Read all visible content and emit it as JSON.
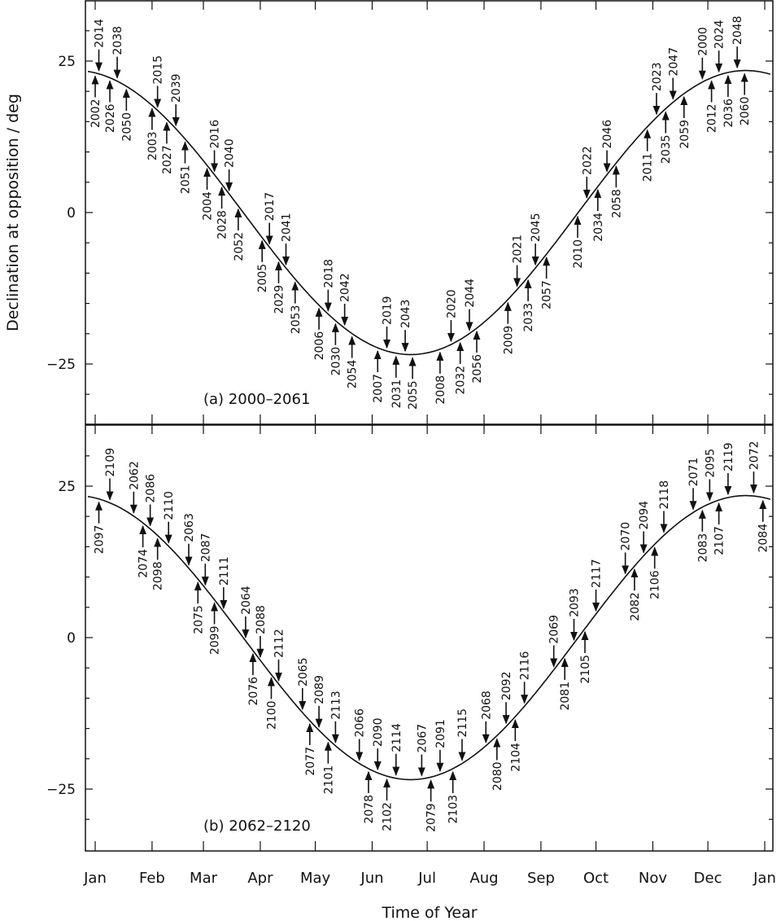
{
  "chart_data": {
    "type": "scatter",
    "xlabel": "Time of Year",
    "ylabel": "Declination at opposition / deg",
    "x_ticks": [
      "Jan",
      "Feb",
      "Mar",
      "Apr",
      "May",
      "Jun",
      "Jul",
      "Aug",
      "Sep",
      "Oct",
      "Nov",
      "Dec",
      "Jan"
    ],
    "y_ticks": [
      25,
      0,
      -25
    ],
    "y_tick_labels": [
      "25",
      "0",
      "−25"
    ],
    "ylim": [
      -35,
      35
    ],
    "grid": false,
    "curve": {
      "amplitude_deg": 23.44,
      "minimum_date": "06-22"
    },
    "panels": [
      {
        "label": "(a) 2000–2061",
        "points": [
          {
            "year": "2002",
            "date": "01-01",
            "dir": "up"
          },
          {
            "year": "2014",
            "date": "01-03",
            "dir": "down"
          },
          {
            "year": "2026",
            "date": "01-09",
            "dir": "up"
          },
          {
            "year": "2038",
            "date": "01-13",
            "dir": "down"
          },
          {
            "year": "2050",
            "date": "01-18",
            "dir": "up"
          },
          {
            "year": "2003",
            "date": "02-01",
            "dir": "up"
          },
          {
            "year": "2015",
            "date": "02-04",
            "dir": "down"
          },
          {
            "year": "2027",
            "date": "02-09",
            "dir": "up"
          },
          {
            "year": "2039",
            "date": "02-14",
            "dir": "down"
          },
          {
            "year": "2051",
            "date": "02-19",
            "dir": "up"
          },
          {
            "year": "2004",
            "date": "03-03",
            "dir": "up"
          },
          {
            "year": "2016",
            "date": "03-07",
            "dir": "down"
          },
          {
            "year": "2028",
            "date": "03-11",
            "dir": "up"
          },
          {
            "year": "2040",
            "date": "03-15",
            "dir": "down"
          },
          {
            "year": "2052",
            "date": "03-20",
            "dir": "up"
          },
          {
            "year": "2005",
            "date": "04-02",
            "dir": "up"
          },
          {
            "year": "2017",
            "date": "04-06",
            "dir": "down"
          },
          {
            "year": "2029",
            "date": "04-11",
            "dir": "up"
          },
          {
            "year": "2041",
            "date": "04-15",
            "dir": "down"
          },
          {
            "year": "2053",
            "date": "04-20",
            "dir": "up"
          },
          {
            "year": "2006",
            "date": "05-03",
            "dir": "up"
          },
          {
            "year": "2018",
            "date": "05-08",
            "dir": "down"
          },
          {
            "year": "2030",
            "date": "05-12",
            "dir": "up"
          },
          {
            "year": "2042",
            "date": "05-17",
            "dir": "down"
          },
          {
            "year": "2054",
            "date": "05-21",
            "dir": "up"
          },
          {
            "year": "2007",
            "date": "06-04",
            "dir": "up"
          },
          {
            "year": "2019",
            "date": "06-09",
            "dir": "down"
          },
          {
            "year": "2031",
            "date": "06-14",
            "dir": "up"
          },
          {
            "year": "2043",
            "date": "06-19",
            "dir": "down"
          },
          {
            "year": "2055",
            "date": "06-23",
            "dir": "up"
          },
          {
            "year": "2008",
            "date": "07-08",
            "dir": "up"
          },
          {
            "year": "2020",
            "date": "07-14",
            "dir": "down"
          },
          {
            "year": "2032",
            "date": "07-19",
            "dir": "up"
          },
          {
            "year": "2044",
            "date": "07-24",
            "dir": "down"
          },
          {
            "year": "2056",
            "date": "07-28",
            "dir": "up"
          },
          {
            "year": "2009",
            "date": "08-14",
            "dir": "up"
          },
          {
            "year": "2021",
            "date": "08-19",
            "dir": "down"
          },
          {
            "year": "2033",
            "date": "08-25",
            "dir": "up"
          },
          {
            "year": "2045",
            "date": "08-29",
            "dir": "down"
          },
          {
            "year": "2057",
            "date": "09-04",
            "dir": "up"
          },
          {
            "year": "2010",
            "date": "09-21",
            "dir": "up"
          },
          {
            "year": "2022",
            "date": "09-26",
            "dir": "down"
          },
          {
            "year": "2034",
            "date": "10-02",
            "dir": "up"
          },
          {
            "year": "2046",
            "date": "10-07",
            "dir": "down"
          },
          {
            "year": "2058",
            "date": "10-12",
            "dir": "up"
          },
          {
            "year": "2011",
            "date": "10-29",
            "dir": "up"
          },
          {
            "year": "2023",
            "date": "11-03",
            "dir": "down"
          },
          {
            "year": "2035",
            "date": "11-08",
            "dir": "up"
          },
          {
            "year": "2047",
            "date": "11-12",
            "dir": "down"
          },
          {
            "year": "2059",
            "date": "11-18",
            "dir": "up"
          },
          {
            "year": "2000",
            "date": "11-28",
            "dir": "down"
          },
          {
            "year": "2012",
            "date": "12-03",
            "dir": "up"
          },
          {
            "year": "2024",
            "date": "12-07",
            "dir": "down"
          },
          {
            "year": "2036",
            "date": "12-12",
            "dir": "up"
          },
          {
            "year": "2048",
            "date": "12-17",
            "dir": "down"
          },
          {
            "year": "2060",
            "date": "12-21",
            "dir": "up"
          }
        ]
      },
      {
        "label": "(b) 2062–2120",
        "points": [
          {
            "year": "2097",
            "date": "01-03",
            "dir": "up"
          },
          {
            "year": "2109",
            "date": "01-09",
            "dir": "down"
          },
          {
            "year": "2062",
            "date": "01-22",
            "dir": "down"
          },
          {
            "year": "2074",
            "date": "01-27",
            "dir": "up"
          },
          {
            "year": "2086",
            "date": "01-31",
            "dir": "down"
          },
          {
            "year": "2098",
            "date": "02-04",
            "dir": "up"
          },
          {
            "year": "2110",
            "date": "02-10",
            "dir": "down"
          },
          {
            "year": "2063",
            "date": "02-21",
            "dir": "down"
          },
          {
            "year": "2075",
            "date": "02-26",
            "dir": "up"
          },
          {
            "year": "2087",
            "date": "03-02",
            "dir": "down"
          },
          {
            "year": "2099",
            "date": "03-07",
            "dir": "up"
          },
          {
            "year": "2111",
            "date": "03-12",
            "dir": "down"
          },
          {
            "year": "2064",
            "date": "03-24",
            "dir": "down"
          },
          {
            "year": "2076",
            "date": "03-28",
            "dir": "up"
          },
          {
            "year": "2088",
            "date": "04-01",
            "dir": "down"
          },
          {
            "year": "2100",
            "date": "04-07",
            "dir": "up"
          },
          {
            "year": "2112",
            "date": "04-11",
            "dir": "down"
          },
          {
            "year": "2065",
            "date": "04-24",
            "dir": "down"
          },
          {
            "year": "2077",
            "date": "04-28",
            "dir": "up"
          },
          {
            "year": "2089",
            "date": "05-03",
            "dir": "down"
          },
          {
            "year": "2101",
            "date": "05-08",
            "dir": "up"
          },
          {
            "year": "2113",
            "date": "05-12",
            "dir": "down"
          },
          {
            "year": "2066",
            "date": "05-25",
            "dir": "down"
          },
          {
            "year": "2078",
            "date": "05-30",
            "dir": "up"
          },
          {
            "year": "2090",
            "date": "06-04",
            "dir": "down"
          },
          {
            "year": "2102",
            "date": "06-09",
            "dir": "up"
          },
          {
            "year": "2114",
            "date": "06-14",
            "dir": "down"
          },
          {
            "year": "2067",
            "date": "06-28",
            "dir": "down"
          },
          {
            "year": "2079",
            "date": "07-03",
            "dir": "up"
          },
          {
            "year": "2091",
            "date": "07-08",
            "dir": "down"
          },
          {
            "year": "2103",
            "date": "07-15",
            "dir": "up"
          },
          {
            "year": "2115",
            "date": "07-20",
            "dir": "down"
          },
          {
            "year": "2068",
            "date": "08-02",
            "dir": "down"
          },
          {
            "year": "2080",
            "date": "08-08",
            "dir": "up"
          },
          {
            "year": "2092",
            "date": "08-13",
            "dir": "down"
          },
          {
            "year": "2104",
            "date": "08-18",
            "dir": "up"
          },
          {
            "year": "2116",
            "date": "08-23",
            "dir": "down"
          },
          {
            "year": "2069",
            "date": "09-08",
            "dir": "down"
          },
          {
            "year": "2081",
            "date": "09-14",
            "dir": "up"
          },
          {
            "year": "2093",
            "date": "09-19",
            "dir": "down"
          },
          {
            "year": "2105",
            "date": "09-25",
            "dir": "up"
          },
          {
            "year": "2117",
            "date": "10-01",
            "dir": "down"
          },
          {
            "year": "2070",
            "date": "10-17",
            "dir": "down"
          },
          {
            "year": "2082",
            "date": "10-22",
            "dir": "up"
          },
          {
            "year": "2094",
            "date": "10-27",
            "dir": "down"
          },
          {
            "year": "2106",
            "date": "11-02",
            "dir": "up"
          },
          {
            "year": "2118",
            "date": "11-07",
            "dir": "down"
          },
          {
            "year": "2071",
            "date": "11-23",
            "dir": "down"
          },
          {
            "year": "2083",
            "date": "11-28",
            "dir": "up"
          },
          {
            "year": "2095",
            "date": "12-02",
            "dir": "down"
          },
          {
            "year": "2107",
            "date": "12-07",
            "dir": "up"
          },
          {
            "year": "2119",
            "date": "12-12",
            "dir": "down"
          },
          {
            "year": "2072",
            "date": "12-26",
            "dir": "down"
          },
          {
            "year": "2084",
            "date": "12-31",
            "dir": "up"
          }
        ]
      }
    ]
  }
}
